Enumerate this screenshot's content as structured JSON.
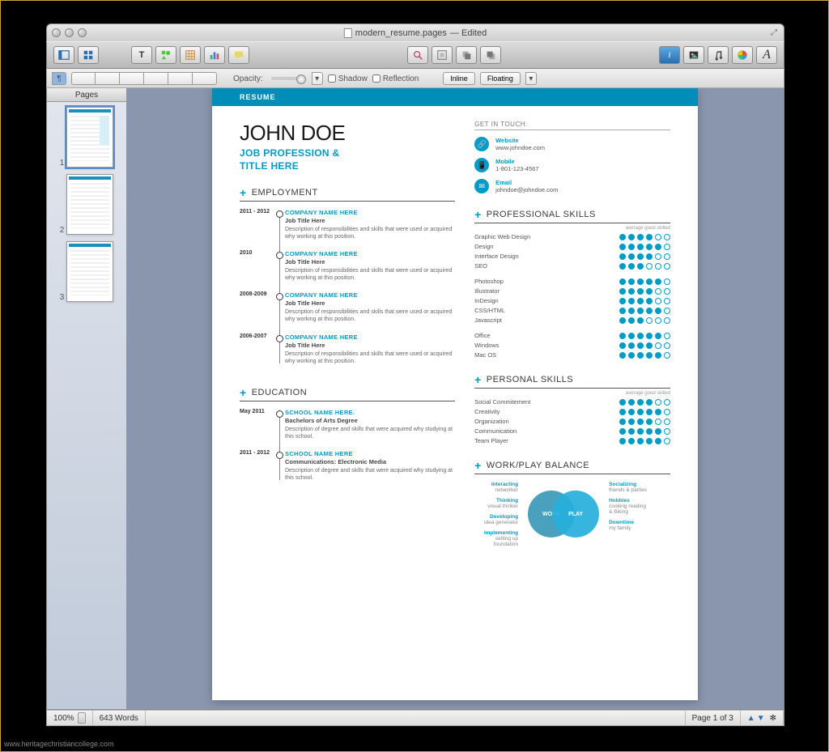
{
  "window": {
    "title": "modern_resume.pages",
    "status": "Edited"
  },
  "formatbar": {
    "opacity_label": "Opacity:",
    "shadow_label": "Shadow",
    "reflection_label": "Reflection",
    "inline_label": "Inline",
    "floating_label": "Floating"
  },
  "sidebar": {
    "title": "Pages",
    "thumbs": [
      "1",
      "2",
      "3"
    ]
  },
  "statusbar": {
    "zoom": "100%",
    "words": "643 Words",
    "page": "Page 1 of 3"
  },
  "doc": {
    "banner": "RESUME",
    "name": "JOHN DOE",
    "title1": "JOB PROFESSION &",
    "title2": "TITLE HERE",
    "contact_header": "GET IN TOUCH:",
    "contacts": [
      {
        "label": "Website",
        "value": "www.johndoe.com"
      },
      {
        "label": "Mobile",
        "value": "1-801-123-4567"
      },
      {
        "label": "Email",
        "value": "johndoe@johndoe.com"
      }
    ],
    "sec_employment": "EMPLOYMENT",
    "employment": [
      {
        "date": "2011 - 2012",
        "company": "COMPANY NAME HERE",
        "job": "Job Title Here",
        "desc": "Description of responsibilities and skills that were used or acquired why working at this position."
      },
      {
        "date": "2010",
        "company": "COMPANY NAME HERE",
        "job": "Job Title Here",
        "desc": "Description of responsibilities and skills that were used or acquired why working at this position."
      },
      {
        "date": "2008-2009",
        "company": "COMPANY NAME HERE",
        "job": "Job Title Here",
        "desc": "Description of responsibilities and skills that were used or acquired why working at this position."
      },
      {
        "date": "2006-2007",
        "company": "COMPANY NAME HERE",
        "job": "Job Title Here",
        "desc": "Description of responsibilities and skills that were used or acquired why working at this position."
      }
    ],
    "sec_education": "EDUCATION",
    "education": [
      {
        "date": "May 2011",
        "school": "SCHOOL NAME HERE.",
        "degree": "Bachelors of Arts Degree",
        "desc": "Description of degree and skills that were acquired why studying at this school."
      },
      {
        "date": "2011 - 2012",
        "school": "SCHOOL NAME HERE",
        "degree": "Communications: Electronic Media",
        "desc": "Description of degree and skills that were acquired why studying at this school."
      }
    ],
    "sec_pro_skills": "PROFESSIONAL SKILLS",
    "skill_legend": "average good skilled",
    "pro_skills_g1": [
      {
        "name": "Graphic Web Design",
        "rating": 4
      },
      {
        "name": "Design",
        "rating": 5
      },
      {
        "name": "Interface Design",
        "rating": 4
      },
      {
        "name": "SEO",
        "rating": 3
      }
    ],
    "pro_skills_g2": [
      {
        "name": "Photoshop",
        "rating": 5
      },
      {
        "name": "Illustrator",
        "rating": 4
      },
      {
        "name": "InDesign",
        "rating": 4
      },
      {
        "name": "CSS/HTML",
        "rating": 5
      },
      {
        "name": "Javascript",
        "rating": 3
      }
    ],
    "pro_skills_g3": [
      {
        "name": "Office",
        "rating": 5
      },
      {
        "name": "Windows",
        "rating": 4
      },
      {
        "name": "Mac OS",
        "rating": 5
      }
    ],
    "sec_personal_skills": "PERSONAL SKILLS",
    "personal_skills": [
      {
        "name": "Social Commitement",
        "rating": 4
      },
      {
        "name": "Creativity",
        "rating": 5
      },
      {
        "name": "Organization",
        "rating": 4
      },
      {
        "name": "Communication",
        "rating": 5
      },
      {
        "name": "Team Player",
        "rating": 5
      }
    ],
    "sec_balance": "WORK/PLAY BALANCE",
    "venn_work": "WORK",
    "venn_play": "PLAY",
    "work_items": [
      {
        "h": "Interacting",
        "s": "networker"
      },
      {
        "h": "Thinking",
        "s": "visual thinker"
      },
      {
        "h": "Developing",
        "s": "idea generator"
      },
      {
        "h": "Implementing",
        "s": "setting up foundation"
      }
    ],
    "play_items": [
      {
        "h": "Socializing",
        "s": "friends & parties"
      },
      {
        "h": "Hobbies",
        "s": "cooking reading & Biking"
      },
      {
        "h": "Downtime",
        "s": "my family"
      }
    ]
  },
  "watermark": "www.heritagechristiancollege.com"
}
